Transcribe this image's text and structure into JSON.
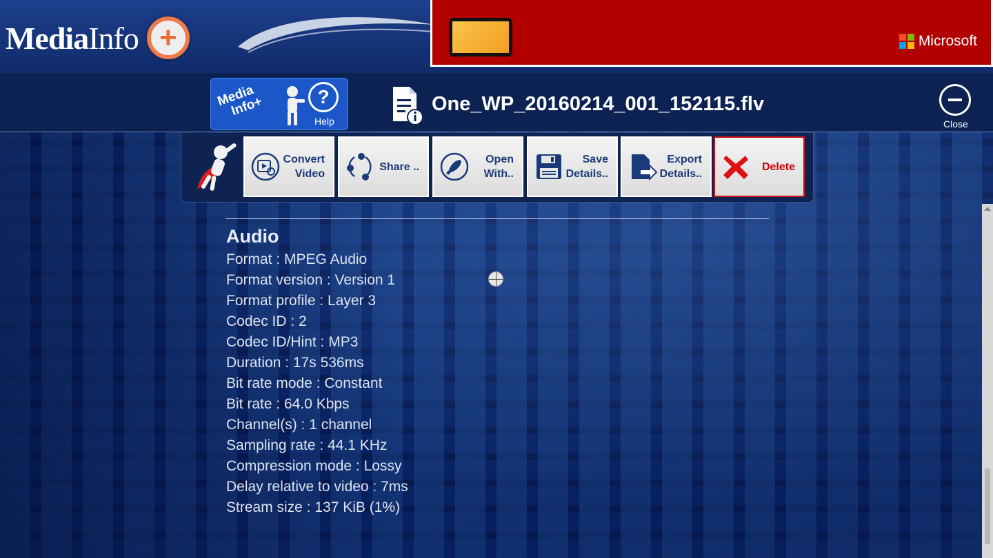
{
  "header": {
    "logo_bold": "Media",
    "logo_light": "Info",
    "logo_plus": "+",
    "ad": {
      "brand": "Microsoft",
      "colors": [
        "#f25022",
        "#7fba00",
        "#00a4ef",
        "#ffb900"
      ]
    }
  },
  "titlebar": {
    "help_logo_line1": "Media",
    "help_logo_line2": "Info+",
    "help_symbol": "?",
    "help_label": "Help",
    "file_name": "One_WP_20160214_001_152115.flv",
    "close_label": "Close"
  },
  "toolbar": {
    "buttons": [
      {
        "label": "Convert\nVideo",
        "icon": "convert-video-icon"
      },
      {
        "label": "Share ..",
        "icon": "share-icon"
      },
      {
        "label": "Open\nWith..",
        "icon": "rocket-icon"
      },
      {
        "label": "Save\nDetails..",
        "icon": "save-icon"
      },
      {
        "label": "Export\nDetails..",
        "icon": "export-icon"
      },
      {
        "label": "Delete",
        "icon": "delete-icon"
      }
    ]
  },
  "details": {
    "section": "Audio",
    "lines": [
      "Format : MPEG Audio",
      "Format version : Version 1",
      "Format profile : Layer 3",
      "Codec ID : 2",
      "Codec ID/Hint : MP3",
      "Duration : 17s 536ms",
      "Bit rate mode : Constant",
      "Bit rate : 64.0 Kbps",
      "Channel(s) : 1 channel",
      "Sampling rate : 44.1 KHz",
      "Compression mode : Lossy",
      "Delay relative to video : 7ms",
      "Stream size : 137 KiB (1%)"
    ]
  },
  "colors": {
    "accent": "#1b57c8",
    "delete": "#cc0000",
    "ad_background": "#b20000"
  }
}
